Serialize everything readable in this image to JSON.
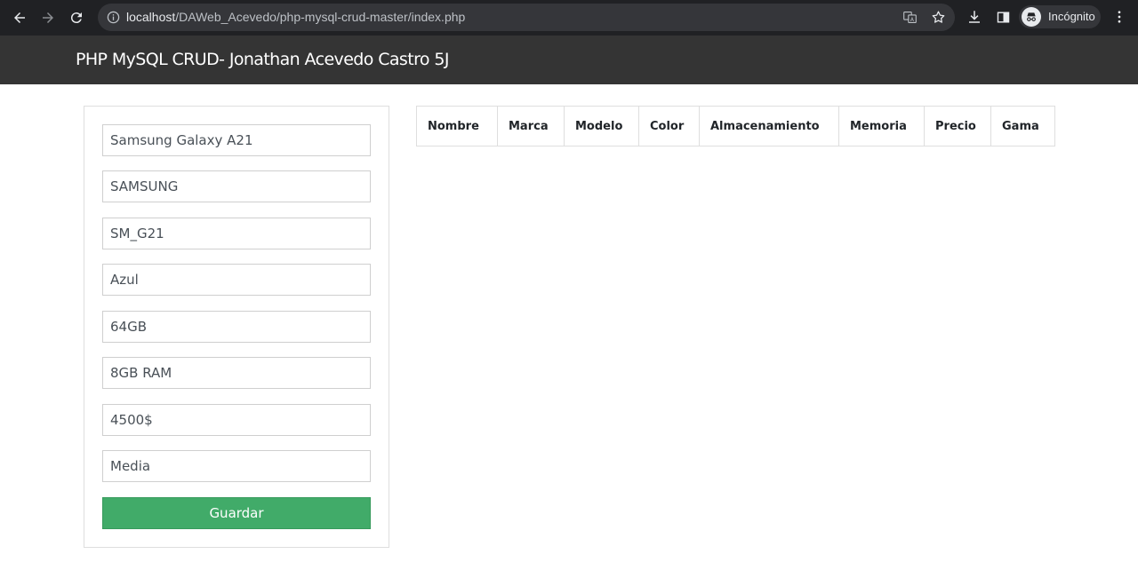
{
  "browser": {
    "url_host": "localhost",
    "url_path": "/DAWeb_Acevedo/php-mysql-crud-master/index.php",
    "profile_label": "Incógnito",
    "icons": [
      "back-icon",
      "forward-icon",
      "reload-icon",
      "info-icon",
      "translate-icon",
      "star-icon",
      "download-icon",
      "side-panel-icon",
      "incognito-icon",
      "menu-icon"
    ]
  },
  "navbar": {
    "brand": "PHP MySQL CRUD- Jonathan Acevedo Castro 5J"
  },
  "form": {
    "fields": [
      {
        "name": "nombre",
        "value": "Samsung Galaxy A21"
      },
      {
        "name": "marca",
        "value": "SAMSUNG"
      },
      {
        "name": "modelo",
        "value": "SM_G21"
      },
      {
        "name": "color",
        "value": "Azul"
      },
      {
        "name": "almacenamiento",
        "value": "64GB"
      },
      {
        "name": "memoria",
        "value": "8GB RAM"
      },
      {
        "name": "precio",
        "value": "4500$"
      },
      {
        "name": "gama",
        "value": "Media"
      }
    ],
    "save_label": "Guardar",
    "save_color": "#41ab69"
  },
  "table": {
    "headers": [
      "Nombre",
      "Marca",
      "Modelo",
      "Color",
      "Almacenamiento",
      "Memoria",
      "Precio",
      "Gama"
    ],
    "rows": []
  }
}
